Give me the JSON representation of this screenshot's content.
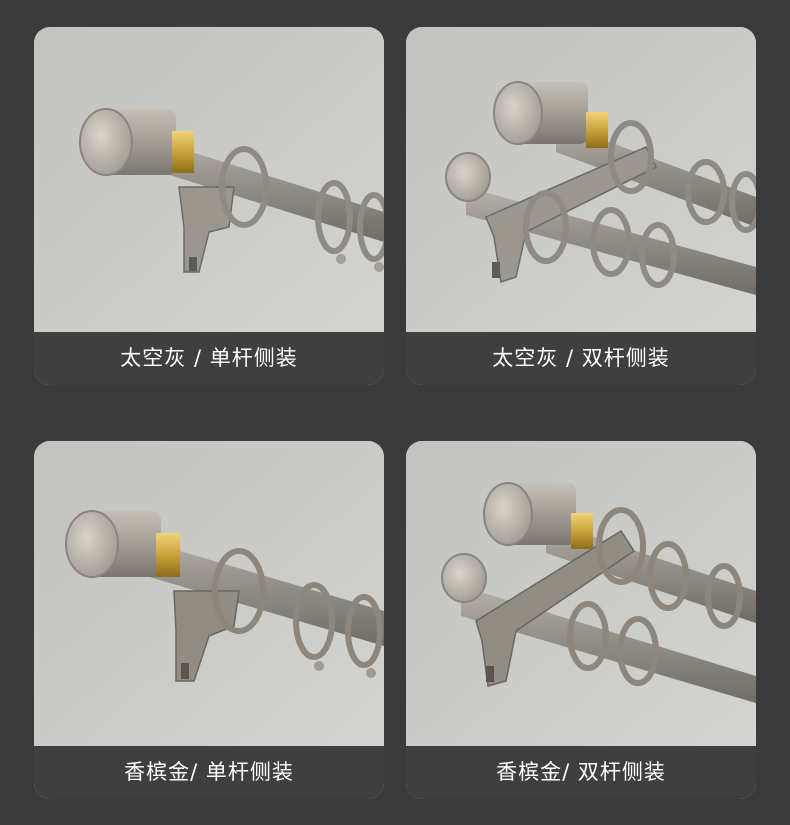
{
  "variants": [
    {
      "caption": "太空灰 / 单杆侧装",
      "finish_color": "#8d8a84",
      "rods": 1
    },
    {
      "caption": "太空灰 / 双杆侧装",
      "finish_color": "#8d8a84",
      "rods": 2
    },
    {
      "caption": "香槟金/ 单杆侧装",
      "finish_color": "#8b8478",
      "rods": 1
    },
    {
      "caption": "香槟金/ 双杆侧装",
      "finish_color": "#8b8478",
      "rods": 2
    }
  ],
  "accent_color": "#c9a23a"
}
